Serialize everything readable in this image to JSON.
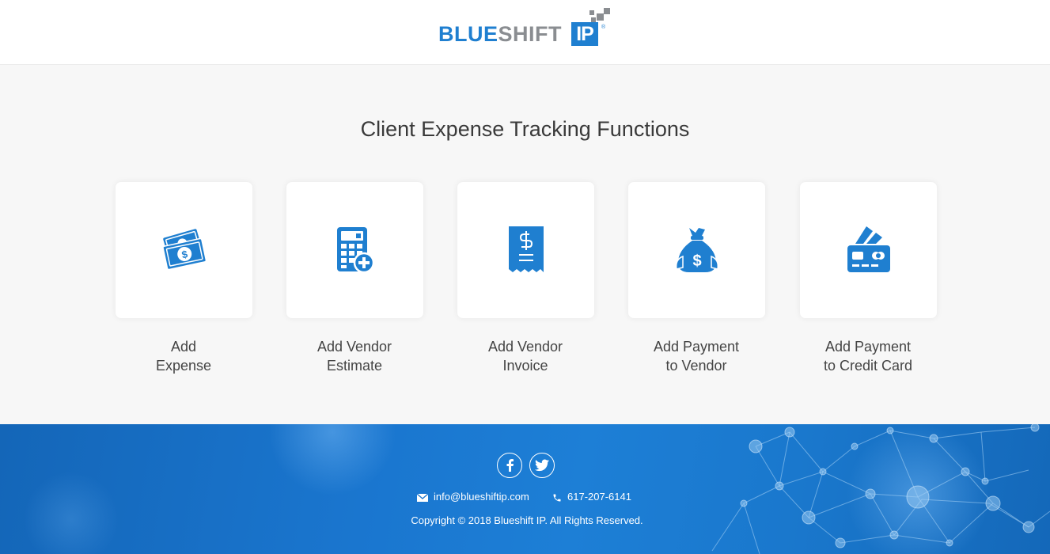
{
  "header": {
    "logo": {
      "word_blue": "BLUE",
      "word_grey": "SHIFT",
      "box": "IP",
      "reg": "®"
    }
  },
  "main": {
    "title": "Client Expense Tracking Functions",
    "cards": [
      {
        "line1": "Add",
        "line2": "Expense",
        "icon": "money-bills-icon"
      },
      {
        "line1": "Add Vendor",
        "line2": "Estimate",
        "icon": "calculator-plus-icon"
      },
      {
        "line1": "Add Vendor",
        "line2": "Invoice",
        "icon": "receipt-icon"
      },
      {
        "line1": "Add Payment",
        "line2": "to Vendor",
        "icon": "money-bag-icon"
      },
      {
        "line1": "Add Payment",
        "line2": "to Credit Card",
        "icon": "credit-card-icon"
      }
    ]
  },
  "footer": {
    "social": [
      "facebook-icon",
      "twitter-icon"
    ],
    "email": "info@blueshiftip.com",
    "phone": "617-207-6141",
    "copyright": "Copyright © 2018 Blueshift IP. All Rights Reserved."
  },
  "colors": {
    "accent": "#1f7fd0",
    "logo_grey": "#8a8d91",
    "footer_bg": "#1a76cf"
  }
}
